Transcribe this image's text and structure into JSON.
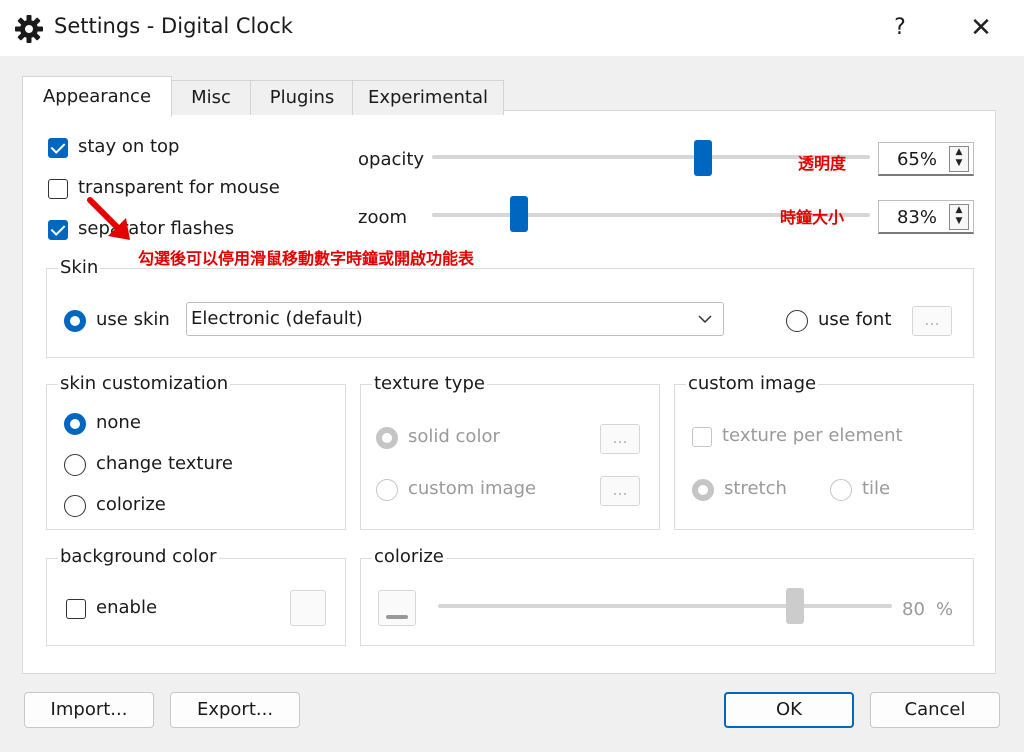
{
  "window": {
    "title": "Settings - Digital Clock",
    "help_label": "?",
    "close_label": "✕",
    "icon": "gear-icon"
  },
  "tabs": [
    {
      "label": "Appearance",
      "active": true
    },
    {
      "label": "Misc"
    },
    {
      "label": "Plugins"
    },
    {
      "label": "Experimental"
    }
  ],
  "appearance": {
    "stay_on_top": {
      "label": "stay on top",
      "checked": true
    },
    "transparent_for_mouse": {
      "label": "transparent for mouse",
      "checked": false
    },
    "separator_flashes": {
      "label": "separator flashes",
      "checked": true
    },
    "opacity": {
      "label": "opacity",
      "value": "65%",
      "level": 0.65
    },
    "zoom": {
      "label": "zoom",
      "value": "83%",
      "level": 0.2
    }
  },
  "skin": {
    "group_label": "Skin",
    "use_skin_label": "use skin",
    "selected_skin": "Electronic (default)",
    "use_font_label": "use font",
    "browse_label": "..."
  },
  "skin_customization": {
    "group_label": "skin customization",
    "none_label": "none",
    "change_texture_label": "change texture",
    "colorize_label": "colorize",
    "selected": "none"
  },
  "texture_type": {
    "group_label": "texture type",
    "solid_color_label": "solid color",
    "custom_image_label": "custom image",
    "browse_label": "..."
  },
  "custom_image": {
    "group_label": "custom image",
    "texture_per_element_label": "texture per element",
    "stretch_label": "stretch",
    "tile_label": "tile"
  },
  "background_color": {
    "group_label": "background color",
    "enable_label": "enable"
  },
  "colorize": {
    "group_label": "colorize",
    "value": "80",
    "unit": "%",
    "level": 0.8
  },
  "footer": {
    "import_label": "Import...",
    "export_label": "Export...",
    "ok_label": "OK",
    "cancel_label": "Cancel"
  },
  "annotations": {
    "opacity_note": "透明度",
    "zoom_note": "時鐘大小",
    "mouse_note": "勾選後可以停用滑鼠移動數字時鐘或開啟功能表"
  },
  "colors": {
    "accent": "#0067c0",
    "annotation": "#e20000"
  }
}
